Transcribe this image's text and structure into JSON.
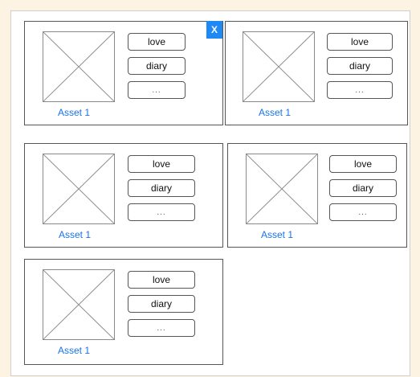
{
  "colors": {
    "background": "#fdf3e2",
    "accent": "#1e88f5",
    "label": "#1a73e8"
  },
  "cards": [
    {
      "label": "Asset 1",
      "tags": [
        "love",
        "diary",
        "..."
      ],
      "close": "X"
    },
    {
      "label": "Asset 1",
      "tags": [
        "love",
        "diary",
        "..."
      ]
    },
    {
      "label": "Asset 1",
      "tags": [
        "love",
        "diary",
        "..."
      ]
    },
    {
      "label": "Asset 1",
      "tags": [
        "love",
        "diary",
        "..."
      ]
    },
    {
      "label": "Asset 1",
      "tags": [
        "love",
        "diary",
        "..."
      ]
    }
  ],
  "icons": {
    "placeholder": "image-placeholder-icon",
    "close": "close-icon"
  }
}
